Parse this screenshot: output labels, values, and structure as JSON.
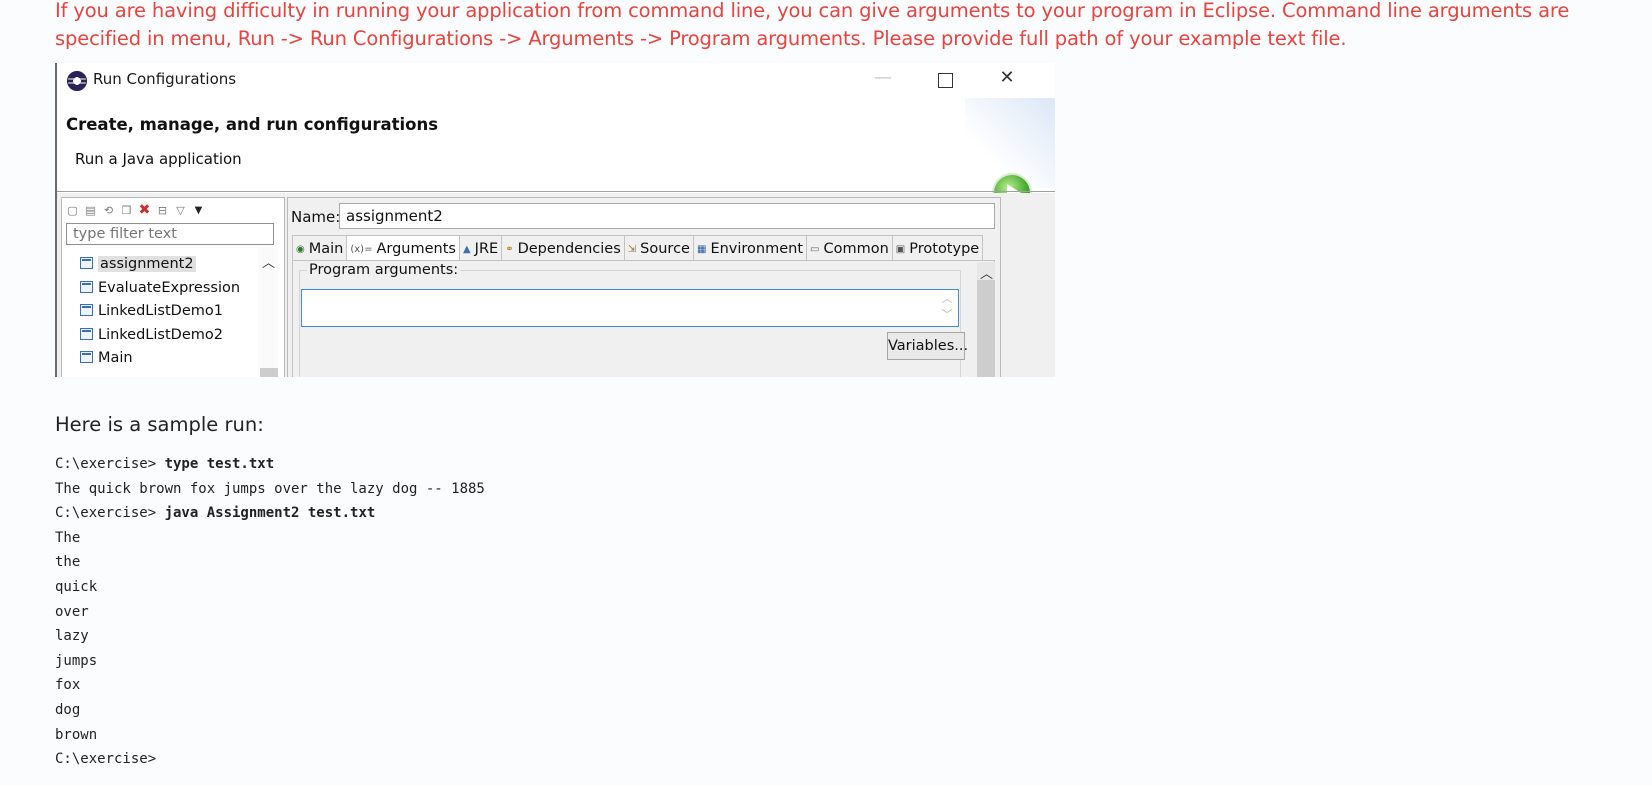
{
  "intro": {
    "text": "If you are having difficulty in running your application from command line, you can give arguments to your program in Eclipse. Command line arguments are specified in menu, Run -> Run Configurations -> Arguments -> Program arguments. Please provide full path of your example text file."
  },
  "dialog": {
    "window_title": "Run Configurations",
    "header_title": "Create, manage, and run configurations",
    "header_subtitle": "Run a Java application",
    "filter_placeholder": "type filter text",
    "tree_items": [
      "assignment2",
      "EvaluateExpression",
      "LinkedListDemo1",
      "LinkedListDemo2",
      "Main"
    ],
    "selected_item": "assignment2",
    "name_label": "Name:",
    "name_value": "assignment2",
    "tabs": [
      "Main",
      "Arguments",
      "JRE",
      "Dependencies",
      "Source",
      "Environment",
      "Common",
      "Prototype"
    ],
    "active_tab": "Arguments",
    "program_arguments_label": "Program arguments:",
    "program_arguments_value": "",
    "variables_button": "Variables..."
  },
  "sample": {
    "heading": "Here is a sample run:",
    "lines": [
      {
        "prompt": "C:\\exercise> ",
        "cmd": "type test.txt"
      },
      {
        "prompt": "The quick brown fox jumps over the lazy dog -- 1885",
        "cmd": ""
      },
      {
        "prompt": "C:\\exercise> ",
        "cmd": "java Assignment2 test.txt"
      },
      {
        "prompt": "The",
        "cmd": ""
      },
      {
        "prompt": "the",
        "cmd": ""
      },
      {
        "prompt": "quick",
        "cmd": ""
      },
      {
        "prompt": "over",
        "cmd": ""
      },
      {
        "prompt": "lazy",
        "cmd": ""
      },
      {
        "prompt": "jumps",
        "cmd": ""
      },
      {
        "prompt": "fox",
        "cmd": ""
      },
      {
        "prompt": "dog",
        "cmd": ""
      },
      {
        "prompt": "brown",
        "cmd": ""
      },
      {
        "prompt": "C:\\exercise>",
        "cmd": ""
      }
    ]
  }
}
